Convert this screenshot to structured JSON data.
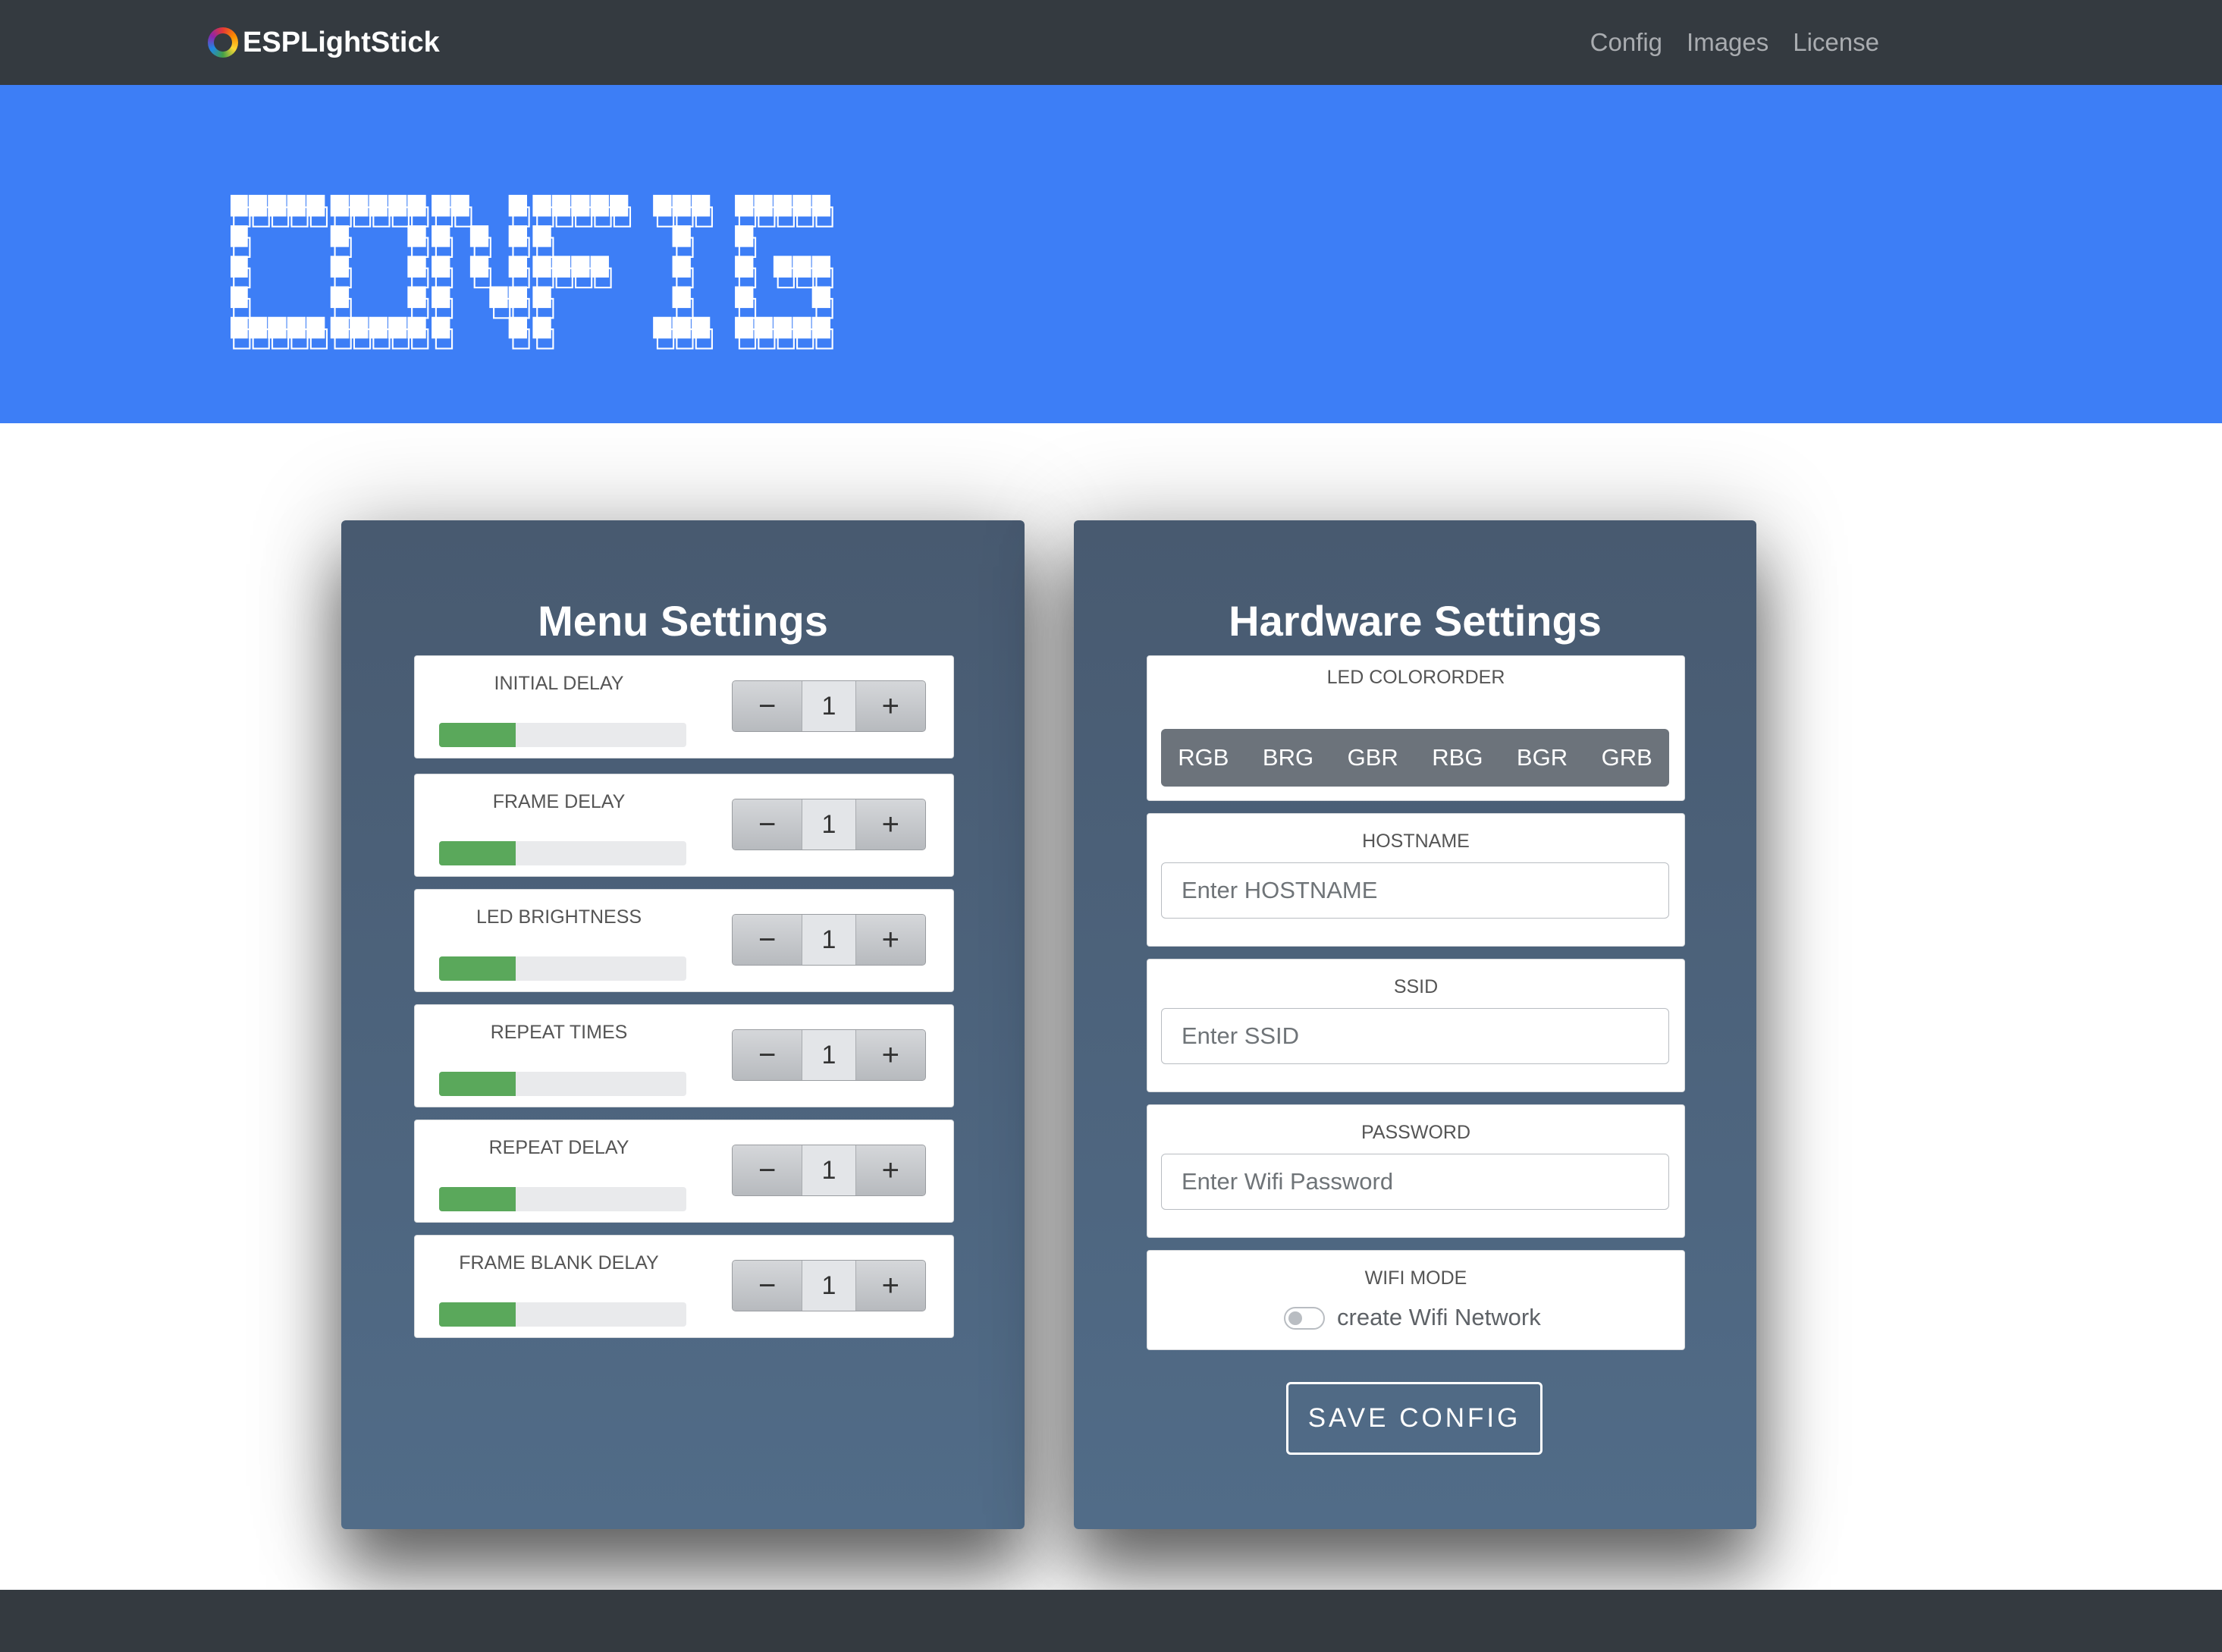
{
  "navbar": {
    "brand": "ESPLightStick",
    "links": [
      "Config",
      "Images",
      "License"
    ]
  },
  "hero": {
    "banner_text": "CONFIG",
    "background_color": "#3d7ef6"
  },
  "menu_settings": {
    "title": "Menu Settings",
    "items": [
      {
        "label": "INITIAL DELAY",
        "value": "1",
        "progress": 0.31
      },
      {
        "label": "FRAME DELAY",
        "value": "1",
        "progress": 0.31
      },
      {
        "label": "LED BRIGHTNESS",
        "value": "1",
        "progress": 0.31
      },
      {
        "label": "REPEAT TIMES",
        "value": "1",
        "progress": 0.31
      },
      {
        "label": "REPEAT DELAY",
        "value": "1",
        "progress": 0.31
      },
      {
        "label": "FRAME BLANK DELAY",
        "value": "1",
        "progress": 0.31
      }
    ],
    "decrement_symbol": "−",
    "increment_symbol": "+",
    "progress_color": "#5aa85b"
  },
  "hardware_settings": {
    "title": "Hardware Settings",
    "led_colororder": {
      "label": "LED COLORORDER",
      "options": [
        "RGB",
        "BRG",
        "GBR",
        "RBG",
        "BGR",
        "GRB"
      ]
    },
    "hostname": {
      "label": "HOSTNAME",
      "placeholder": "Enter HOSTNAME",
      "value": ""
    },
    "ssid": {
      "label": "SSID",
      "placeholder": "Enter SSID",
      "value": ""
    },
    "password": {
      "label": "PASSWORD",
      "placeholder": "Enter Wifi Password",
      "value": ""
    },
    "wifi_mode": {
      "label": "WIFI MODE",
      "toggle_label": "create Wifi Network",
      "checked": false
    },
    "save_label": "SAVE CONFIG"
  }
}
